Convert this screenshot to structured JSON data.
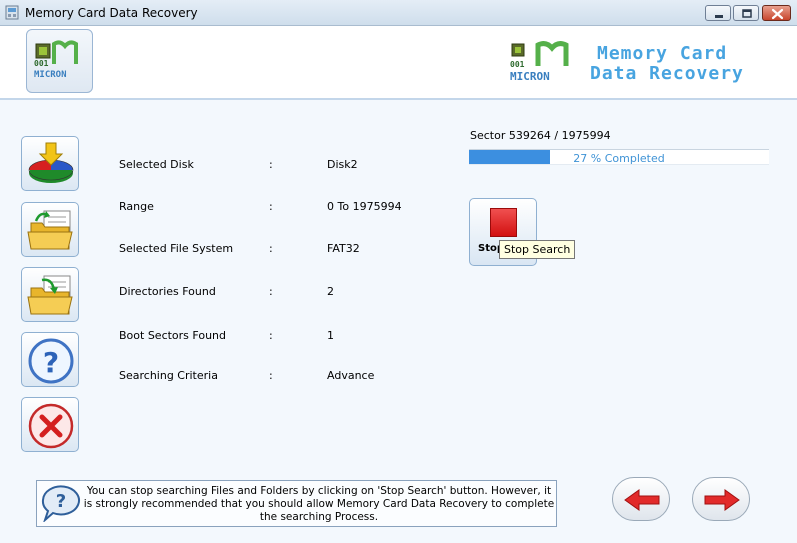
{
  "window": {
    "title": "Memory Card Data Recovery"
  },
  "header": {
    "brand_line1": "Memory Card",
    "brand_line2": "Data Recovery",
    "logo_text": "MICRON",
    "logo_digits": "001"
  },
  "details": [
    {
      "label": "Selected Disk",
      "colon": ":",
      "value": "Disk2"
    },
    {
      "label": "Range",
      "colon": ":",
      "value": "0 To 1975994"
    },
    {
      "label": "Selected File System",
      "colon": ":",
      "value": "FAT32"
    },
    {
      "label": "Directories Found",
      "colon": ":",
      "value": "2"
    },
    {
      "label": "Boot Sectors Found",
      "colon": ":",
      "value": "1"
    },
    {
      "label": "Searching Criteria",
      "colon": ":",
      "value": "Advance"
    }
  ],
  "scan": {
    "sector_label": "Sector",
    "sector_current": "539264",
    "sector_total": "1975994",
    "progress_percent": 27,
    "progress_text": "27 % Completed"
  },
  "stop_button": {
    "label": "Stop",
    "tooltip": "Stop Search"
  },
  "help": {
    "text": "You can stop searching Files and Folders by clicking on 'Stop Search' button. However, it is strongly recommended that you should allow Memory Card Data Recovery to complete the searching Process."
  },
  "colors": {
    "accent": "#48a4e0",
    "progress": "#3c8fe0",
    "stop": "#e02020"
  },
  "icons": {
    "sidebar": [
      "disk-recovery-icon",
      "folder-open-icon",
      "folder-restore-icon",
      "help-icon",
      "exit-icon"
    ],
    "nav": [
      "back-arrow-icon",
      "next-arrow-icon"
    ]
  }
}
